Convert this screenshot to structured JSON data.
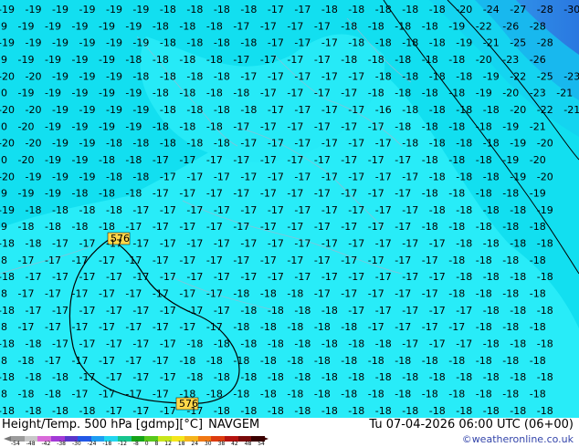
{
  "title": "Height/Temp. 500 hPa [gdmp][°C]",
  "model": "NAVGEM",
  "datetime": "Tu 07-04-2026 06:00 UTC (06+00)",
  "credit": "©weatheronline.co.uk",
  "contour_labels": [
    "576",
    "576"
  ],
  "colorbar": {
    "ticks": [
      "-54",
      "-48",
      "-42",
      "-38",
      "-30",
      "-24",
      "-18",
      "-12",
      "-8",
      "0",
      "8",
      "12",
      "18",
      "24",
      "30",
      "38",
      "42",
      "48",
      "54"
    ],
    "colors": [
      "#9b9b9b",
      "#c8c8c8",
      "#d96ad9",
      "#a23ad6",
      "#5a36c9",
      "#2258e6",
      "#1e9df2",
      "#22d6f0",
      "#17c48e",
      "#16a318",
      "#58c81c",
      "#c8e61c",
      "#f5e61c",
      "#f5b41c",
      "#f07814",
      "#dc3c10",
      "#b41410",
      "#7a0a0a",
      "#3a0000"
    ]
  },
  "temperature_rows": [
    [
      "-19",
      "-19",
      "-19",
      "-19",
      "-19",
      "-19",
      "-18",
      "-18",
      "-18",
      "-18",
      "-17",
      "-17",
      "-18",
      "-18",
      "-18",
      "-18",
      "-18",
      "-20",
      "-24",
      "-27",
      "-28",
      "-30"
    ],
    [
      "-19",
      "-19",
      "-19",
      "-19",
      "-19",
      "-19",
      "-18",
      "-18",
      "-18",
      "-17",
      "-17",
      "-17",
      "-17",
      "-18",
      "-18",
      "-18",
      "-18",
      "-19",
      "-22",
      "-26",
      "-28"
    ],
    [
      "-19",
      "-19",
      "-19",
      "-19",
      "-19",
      "-19",
      "-18",
      "-18",
      "-18",
      "-18",
      "-17",
      "-17",
      "-17",
      "-18",
      "-18",
      "-18",
      "-18",
      "-19",
      "-21",
      "-25",
      "-28"
    ],
    [
      "-19",
      "-19",
      "-19",
      "-19",
      "-19",
      "-18",
      "-18",
      "-18",
      "-18",
      "-17",
      "-17",
      "-17",
      "-17",
      "-18",
      "-18",
      "-18",
      "-18",
      "-18",
      "-20",
      "-23",
      "-26"
    ],
    [
      "-20",
      "-20",
      "-19",
      "-19",
      "-19",
      "-18",
      "-18",
      "-18",
      "-18",
      "-17",
      "-17",
      "-17",
      "-17",
      "-17",
      "-18",
      "-18",
      "-18",
      "-18",
      "-19",
      "-22",
      "-25",
      "-23"
    ],
    [
      "-20",
      "-19",
      "-19",
      "-19",
      "-19",
      "-19",
      "-18",
      "-18",
      "-18",
      "-18",
      "-17",
      "-17",
      "-17",
      "-17",
      "-18",
      "-18",
      "-18",
      "-18",
      "-19",
      "-20",
      "-23",
      "-21"
    ],
    [
      "-20",
      "-20",
      "-19",
      "-19",
      "-19",
      "-19",
      "-18",
      "-18",
      "-18",
      "-18",
      "-17",
      "-17",
      "-17",
      "-17",
      "-16",
      "-18",
      "-18",
      "-18",
      "-18",
      "-20",
      "-22",
      "-21"
    ],
    [
      "-20",
      "-20",
      "-19",
      "-19",
      "-19",
      "-19",
      "-18",
      "-18",
      "-18",
      "-17",
      "-17",
      "-17",
      "-17",
      "-17",
      "-17",
      "-18",
      "-18",
      "-18",
      "-18",
      "-19",
      "-21"
    ],
    [
      "-20",
      "-20",
      "-19",
      "-19",
      "-18",
      "-18",
      "-18",
      "-18",
      "-18",
      "-17",
      "-17",
      "-17",
      "-17",
      "-17",
      "-17",
      "-18",
      "-18",
      "-18",
      "-18",
      "-19",
      "-20"
    ],
    [
      "-20",
      "-20",
      "-19",
      "-19",
      "-18",
      "-18",
      "-17",
      "-17",
      "-17",
      "-17",
      "-17",
      "-17",
      "-17",
      "-17",
      "-17",
      "-17",
      "-18",
      "-18",
      "-18",
      "-19",
      "-20"
    ],
    [
      "-20",
      "-19",
      "-19",
      "-19",
      "-18",
      "-18",
      "-17",
      "-17",
      "-17",
      "-17",
      "-17",
      "-17",
      "-17",
      "-17",
      "-17",
      "-17",
      "-18",
      "-18",
      "-18",
      "-19",
      "-20"
    ],
    [
      "-19",
      "-19",
      "-19",
      "-18",
      "-18",
      "-18",
      "-17",
      "-17",
      "-17",
      "-17",
      "-17",
      "-17",
      "-17",
      "-17",
      "-17",
      "-17",
      "-18",
      "-18",
      "-18",
      "-18",
      "-19"
    ],
    [
      "-19",
      "-18",
      "-18",
      "-18",
      "-18",
      "-17",
      "-17",
      "-17",
      "-17",
      "-17",
      "-17",
      "-17",
      "-17",
      "-17",
      "-17",
      "-17",
      "-18",
      "-18",
      "-18",
      "-18",
      "-19"
    ],
    [
      "-19",
      "-18",
      "-18",
      "-18",
      "-18",
      "-17",
      "-17",
      "-17",
      "-17",
      "-17",
      "-17",
      "-17",
      "-17",
      "-17",
      "-17",
      "-17",
      "-18",
      "-18",
      "-18",
      "-18",
      "-18"
    ],
    [
      "-18",
      "-18",
      "-17",
      "-17",
      "-17",
      "-17",
      "-17",
      "-17",
      "-17",
      "-17",
      "-17",
      "-17",
      "-17",
      "-17",
      "-17",
      "-17",
      "-17",
      "-18",
      "-18",
      "-18",
      "-18"
    ],
    [
      "-18",
      "-17",
      "-17",
      "-17",
      "-17",
      "-17",
      "-17",
      "-17",
      "-17",
      "-17",
      "-17",
      "-17",
      "-17",
      "-17",
      "-17",
      "-17",
      "-17",
      "-18",
      "-18",
      "-18",
      "-18"
    ],
    [
      "-18",
      "-17",
      "-17",
      "-17",
      "-17",
      "-17",
      "-17",
      "-17",
      "-17",
      "-17",
      "-17",
      "-17",
      "-17",
      "-17",
      "-17",
      "-17",
      "-17",
      "-18",
      "-18",
      "-18",
      "-18"
    ],
    [
      "-18",
      "-17",
      "-17",
      "-17",
      "-17",
      "-17",
      "-17",
      "-17",
      "-17",
      "-18",
      "-18",
      "-18",
      "-17",
      "-17",
      "-17",
      "-17",
      "-17",
      "-18",
      "-18",
      "-18",
      "-18"
    ],
    [
      "-18",
      "-17",
      "-17",
      "-17",
      "-17",
      "-17",
      "-17",
      "-17",
      "-17",
      "-18",
      "-18",
      "-18",
      "-18",
      "-17",
      "-17",
      "-17",
      "-17",
      "-17",
      "-18",
      "-18",
      "-18"
    ],
    [
      "-18",
      "-17",
      "-17",
      "-17",
      "-17",
      "-17",
      "-17",
      "-17",
      "-17",
      "-18",
      "-18",
      "-18",
      "-18",
      "-18",
      "-17",
      "-17",
      "-17",
      "-17",
      "-18",
      "-18",
      "-18"
    ],
    [
      "-18",
      "-18",
      "-17",
      "-17",
      "-17",
      "-17",
      "-17",
      "-18",
      "-18",
      "-18",
      "-18",
      "-18",
      "-18",
      "-18",
      "-18",
      "-17",
      "-17",
      "-17",
      "-18",
      "-18",
      "-18"
    ],
    [
      "-18",
      "-18",
      "-17",
      "-17",
      "-17",
      "-17",
      "-17",
      "-18",
      "-18",
      "-18",
      "-18",
      "-18",
      "-18",
      "-18",
      "-18",
      "-18",
      "-18",
      "-18",
      "-18",
      "-18",
      "-18"
    ],
    [
      "-18",
      "-18",
      "-18",
      "-17",
      "-17",
      "-17",
      "-17",
      "-18",
      "-18",
      "-18",
      "-18",
      "-18",
      "-18",
      "-18",
      "-18",
      "-18",
      "-18",
      "-18",
      "-18",
      "-18",
      "-18"
    ],
    [
      "-18",
      "-18",
      "-18",
      "-17",
      "-17",
      "-17",
      "-17",
      "-18",
      "-18",
      "-18",
      "-18",
      "-18",
      "-18",
      "-18",
      "-18",
      "-18",
      "-18",
      "-18",
      "-18",
      "-18",
      "-18"
    ],
    [
      "-18",
      "-18",
      "-18",
      "-18",
      "-17",
      "-17",
      "-17",
      "-17",
      "-18",
      "-18",
      "-18",
      "-18",
      "-18",
      "-18",
      "-18",
      "-18",
      "-18",
      "-18",
      "-18",
      "-18",
      "-18"
    ]
  ]
}
